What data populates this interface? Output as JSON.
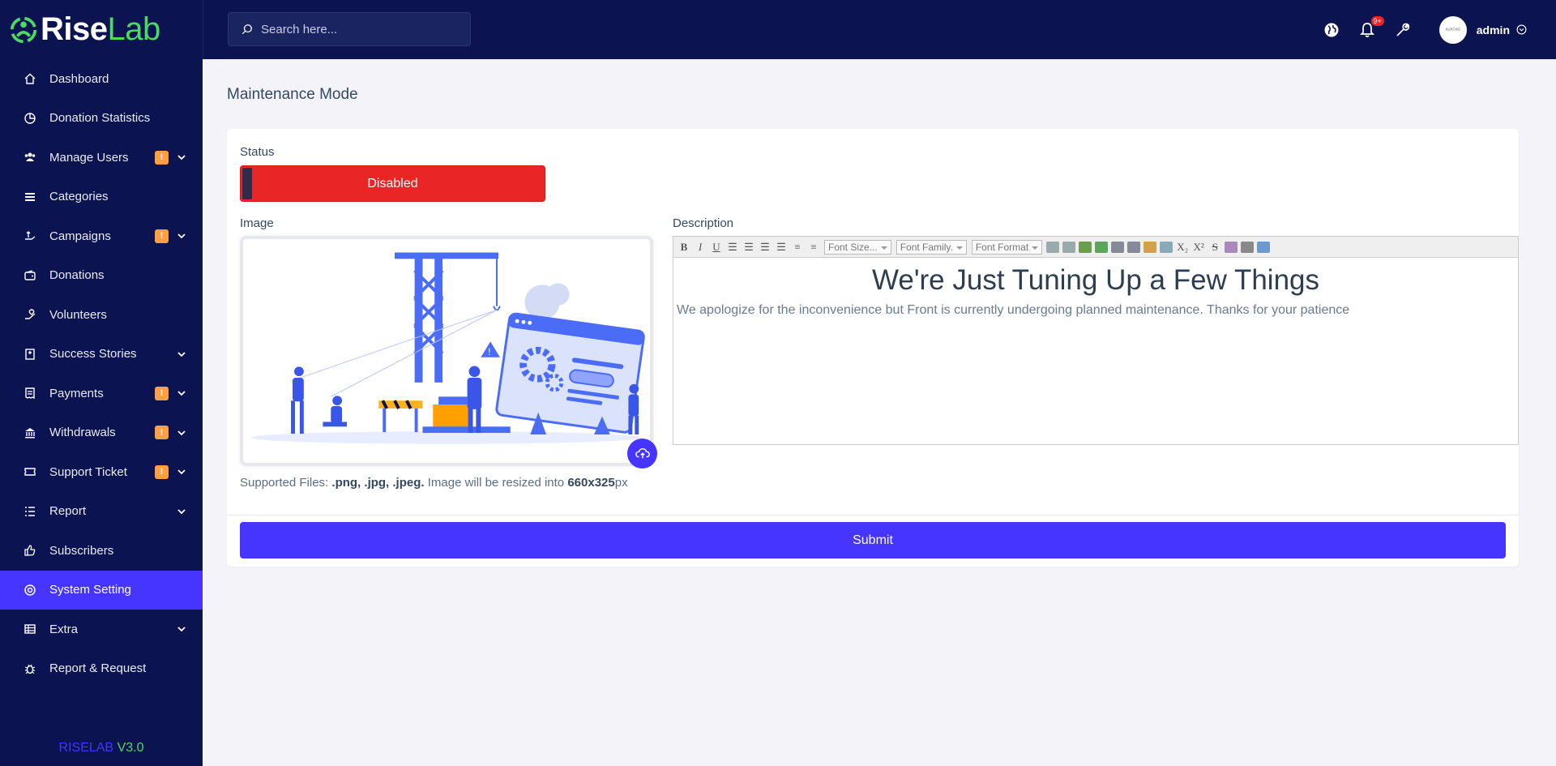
{
  "brand": {
    "rise": "Rise",
    "lab": "Lab",
    "accent": "#4cd964"
  },
  "sidebar": {
    "items": [
      {
        "label": "Dashboard",
        "icon": "home-icon"
      },
      {
        "label": "Donation Statistics",
        "icon": "pie-chart-icon"
      },
      {
        "label": "Manage Users",
        "icon": "users-icon",
        "badge": "!",
        "chevron": true
      },
      {
        "label": "Categories",
        "icon": "stack-icon"
      },
      {
        "label": "Campaigns",
        "icon": "hand-icon",
        "badge": "!",
        "chevron": true
      },
      {
        "label": "Donations",
        "icon": "wallet-icon"
      },
      {
        "label": "Volunteers",
        "icon": "hand-heart-icon"
      },
      {
        "label": "Success Stories",
        "icon": "book-icon",
        "chevron": true
      },
      {
        "label": "Payments",
        "icon": "invoice-icon",
        "badge": "!",
        "chevron": true
      },
      {
        "label": "Withdrawals",
        "icon": "bank-icon",
        "badge": "!",
        "chevron": true
      },
      {
        "label": "Support Ticket",
        "icon": "ticket-icon",
        "badge": "!",
        "chevron": true
      },
      {
        "label": "Report",
        "icon": "list-icon",
        "chevron": true
      },
      {
        "label": "Subscribers",
        "icon": "thumbs-up-icon"
      },
      {
        "label": "System Setting",
        "icon": "life-ring-icon",
        "active": true
      },
      {
        "label": "Extra",
        "icon": "table-icon",
        "chevron": true
      },
      {
        "label": "Report & Request",
        "icon": "bug-icon"
      }
    ],
    "version_name": "RISELAB",
    "version_num": "V3.0"
  },
  "topbar": {
    "search_placeholder": "Search here...",
    "notification_count": "9+",
    "avatar_text": "AVATAR",
    "username": "admin"
  },
  "page": {
    "title": "Maintenance Mode",
    "status_label": "Status",
    "status_value": "Disabled",
    "image_label": "Image",
    "supported_prefix": "Supported Files:",
    "supported_types": ".png, .jpg, .jpeg.",
    "supported_middle": "Image will be resized into",
    "supported_size": "660x325",
    "supported_unit": "px",
    "description_label": "Description",
    "toolbar": {
      "font_size": "Font Size...",
      "font_family": "Font Family.",
      "font_format": "Font Format"
    },
    "editor_heading": "We're Just Tuning Up a Few Things",
    "editor_text": "We apologize for the inconvenience but Front is currently undergoing planned maintenance. Thanks for your patience",
    "submit_label": "Submit"
  },
  "colors": {
    "primary": "#4634ff",
    "sidebar": "#0b1451",
    "danger": "#ea2525",
    "warning": "#ff9f43"
  }
}
